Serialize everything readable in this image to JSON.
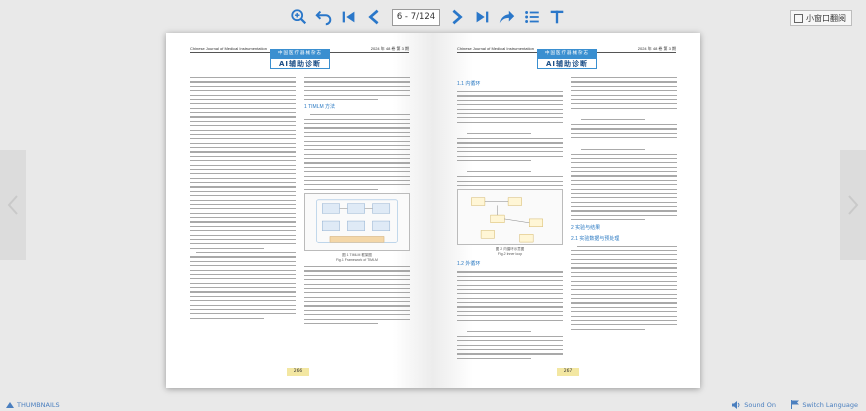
{
  "toolbar": {
    "page_indicator": "6 - 7/124",
    "mini_window_label": "小窗口翻阅",
    "icons": [
      "zoom-in-icon",
      "undo-icon",
      "first-page-icon",
      "previous-page-icon",
      "next-page-icon",
      "last-page-icon",
      "share-icon",
      "list-icon",
      "text-icon"
    ],
    "accent": "#2a77c9"
  },
  "book": {
    "left_page": {
      "running_head": "Chinese Journal of Medical Instrumentation",
      "running_head_right": "2024 年 48 卷 第 3 期",
      "badge_top": "中国医疗器械杂志",
      "badge_bottom": "AI辅助诊断",
      "section_title": "1 TIMLM 方法",
      "figure_caption": "图 1 TIMLM 框架图\nFig.1 Framework of TIMLM",
      "page_number": "266"
    },
    "right_page": {
      "running_head": "Chinese Journal of Medical Instrumentation",
      "running_head_right": "2024 年 48 卷 第 3 期",
      "badge_top": "中国医疗器械杂志",
      "badge_bottom": "AI辅助诊断",
      "section_1": "1.1 内循环",
      "section_2": "1.2 外循环",
      "section_3": "2 实验与结果",
      "section_4": "2.1 实验数据与预处理",
      "figure_caption": "图 2 内循环示意图\nFig.2 Inner loop",
      "page_number": "267"
    }
  },
  "status": {
    "thumbnails_label": "THUMBNAILS",
    "sound_label": "Sound On",
    "language_label": "Switch Language"
  },
  "colors": {
    "toolbar_icon": "#2a77c9",
    "status_text": "#4a7fbf",
    "page_number_bg": "#f3e7a2"
  }
}
